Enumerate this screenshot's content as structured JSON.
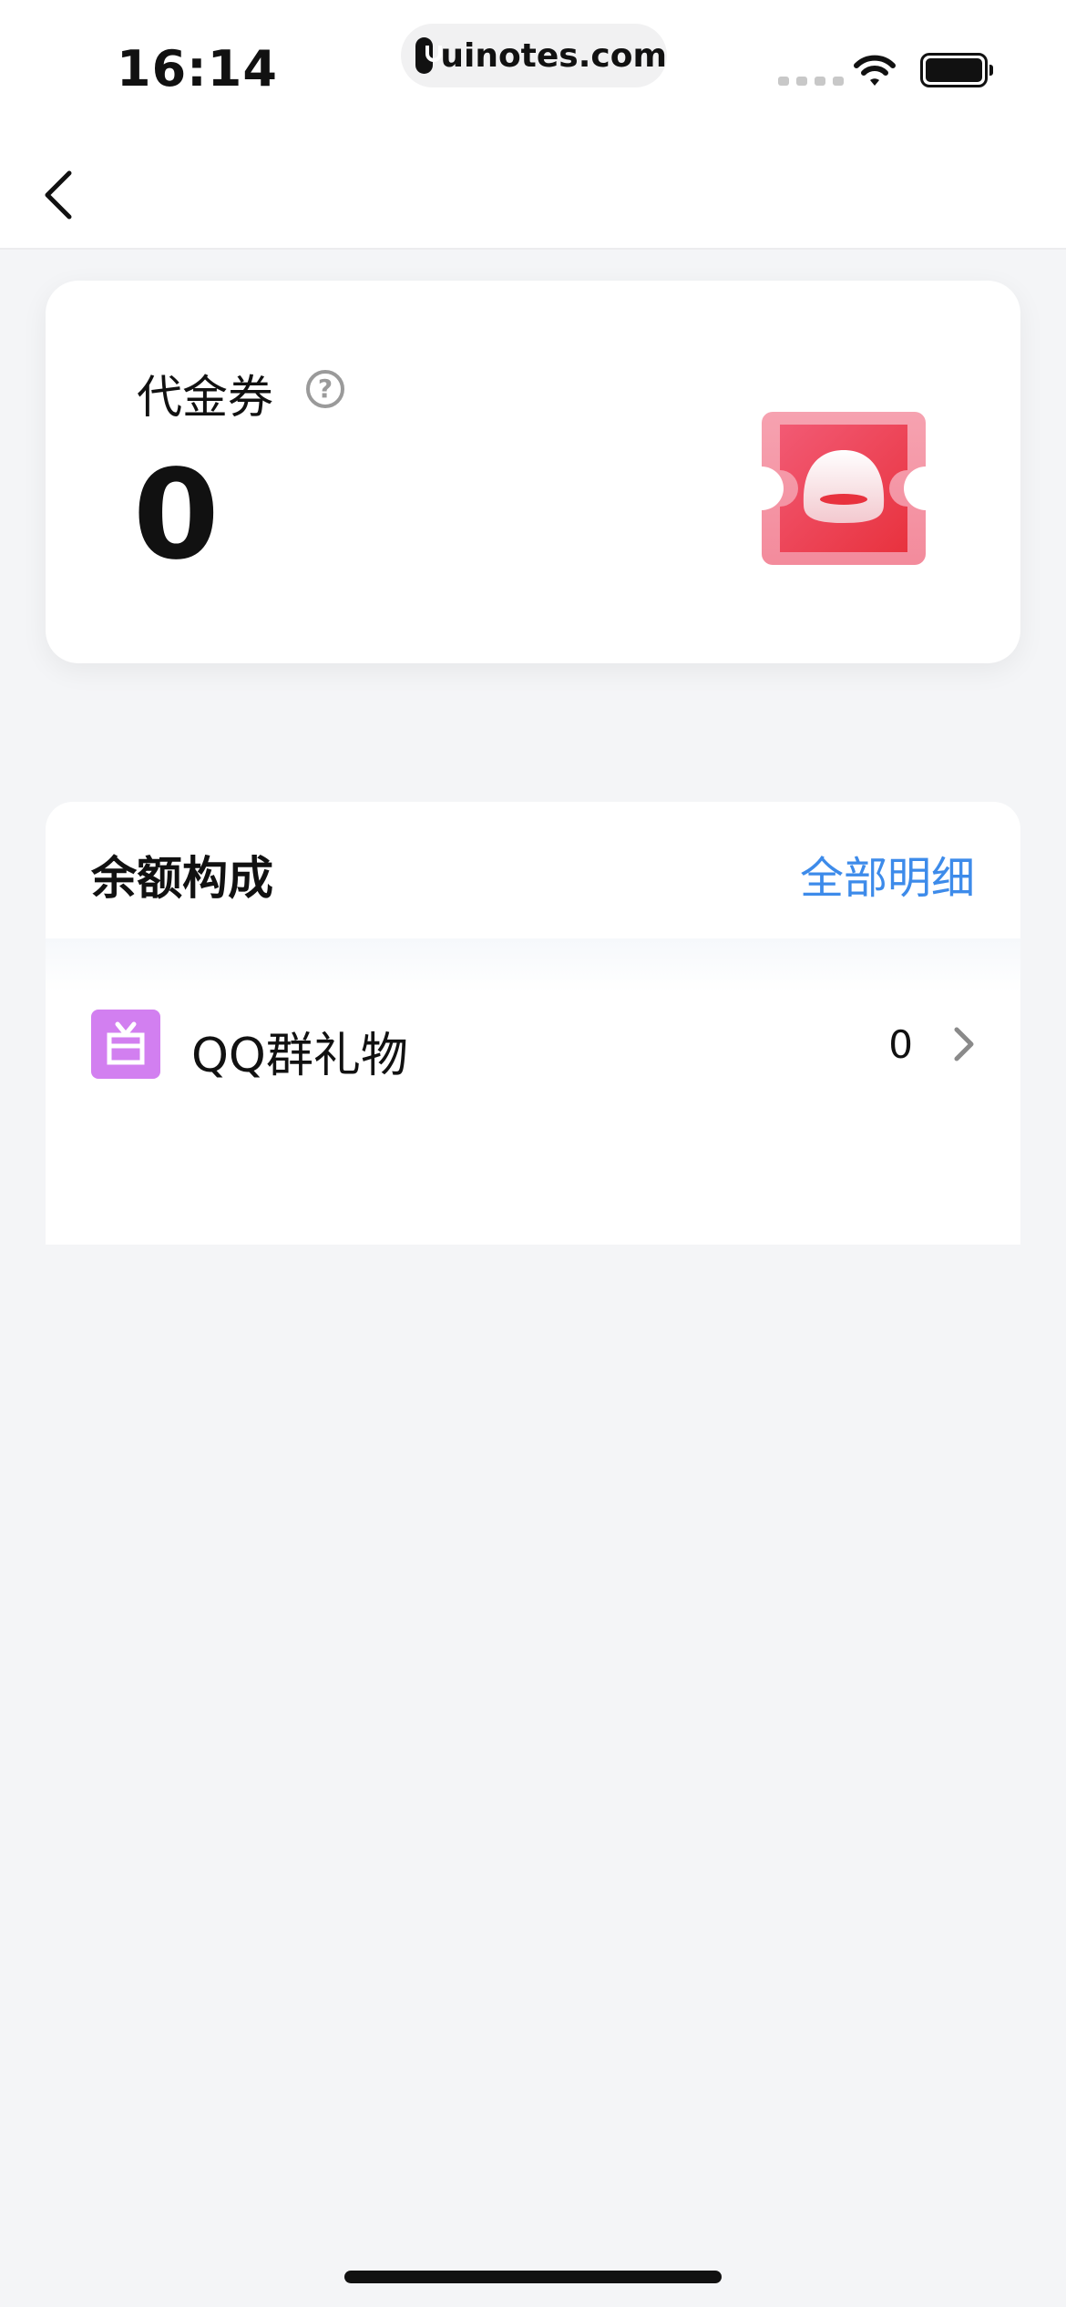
{
  "status_bar": {
    "time": "16:14",
    "url": "uinotes.com"
  },
  "nav": {
    "back_icon": "chevron-left-icon"
  },
  "voucher": {
    "title": "代金券",
    "help_icon": "question-icon",
    "help_glyph": "?",
    "amount": "0",
    "icon": "voucher-ticket-icon"
  },
  "balance": {
    "title": "余额构成",
    "all_details_label": "全部明细",
    "items": [
      {
        "icon": "gift-icon",
        "label": "QQ群礼物",
        "value": "0"
      }
    ]
  },
  "colors": {
    "accent": "#3d8bea",
    "gift_icon_bg": "#d27ff0",
    "voucher_red": "#ee3a4a",
    "page_bg": "#f4f5f7"
  }
}
